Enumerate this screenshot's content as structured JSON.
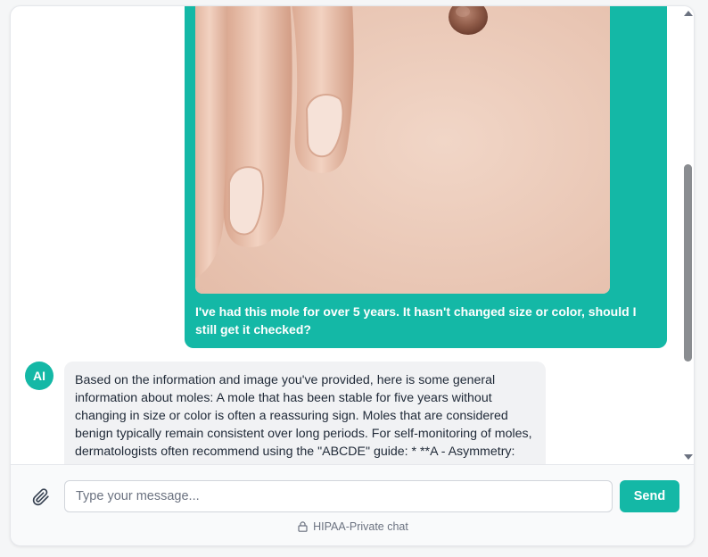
{
  "conversation": {
    "user_message": {
      "image_alt": "Close-up photo of a mole on skin next to fingers",
      "text": "I've had this mole for over 5 years. It hasn't changed size or color, should I still get it checked?"
    },
    "ai_message": {
      "avatar_label": "AI",
      "text": "Based on the information and image you've provided, here is some general information about moles: A mole that has been stable for five years without changing in size or color is often a reassuring sign. Moles that are considered benign typically remain consistent over long periods. For self-monitoring of moles, dermatologists often recommend using the \"ABCDE\" guide: * **A - Asymmetry: One half of the mole doesn't match the other half."
    }
  },
  "composer": {
    "attach_icon": "paperclip-icon",
    "placeholder": "Type your message...",
    "send_label": "Send",
    "privacy_icon": "lock-icon",
    "privacy_text": "HIPAA-Private chat"
  },
  "colors": {
    "accent": "#14b8a6",
    "ai_bubble": "#f1f2f4",
    "scrollbar_thumb": "#8a8d91"
  }
}
